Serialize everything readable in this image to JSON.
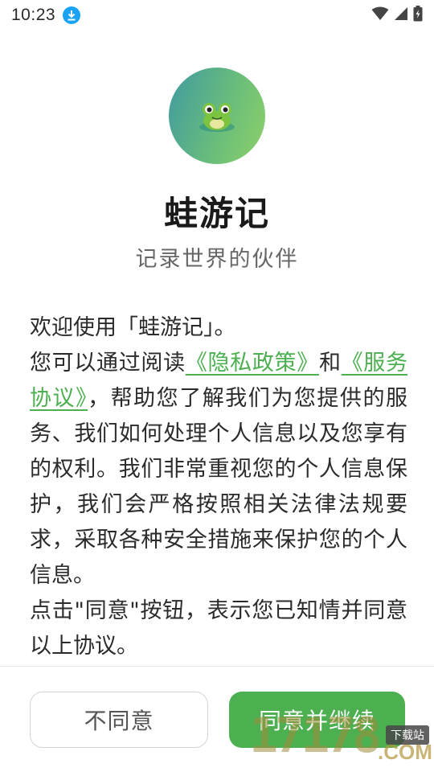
{
  "status_bar": {
    "time": "10:23",
    "icons": [
      "download-icon",
      "wifi-icon",
      "signal-icon",
      "battery-icon"
    ]
  },
  "app": {
    "name": "蛙游记",
    "tagline": "记录世界的伙伴",
    "logo_icon": "frog-logo-icon",
    "accent_color": "#4caf50"
  },
  "agreement": {
    "greeting": "欢迎使用「蛙游记」。",
    "intro": "您可以通过阅读",
    "privacy_link": "《隐私政策》",
    "and": "和",
    "service_link": "《服务协议》",
    "body": "，帮助您了解我们为您提供的服务、我们如何处理个人信息以及您享有的权利。我们非常重视您的个人信息保护，我们会严格按照相关法律法规要求，采取各种安全措施来保护您的个人信息。",
    "consent": "点击\"同意\"按钮，表示您已知情并同意以上协议。"
  },
  "buttons": {
    "disagree": "不同意",
    "agree": "同意并继续"
  },
  "watermark": {
    "number": "17178",
    "domain": ".COM",
    "badge": "下载站"
  }
}
